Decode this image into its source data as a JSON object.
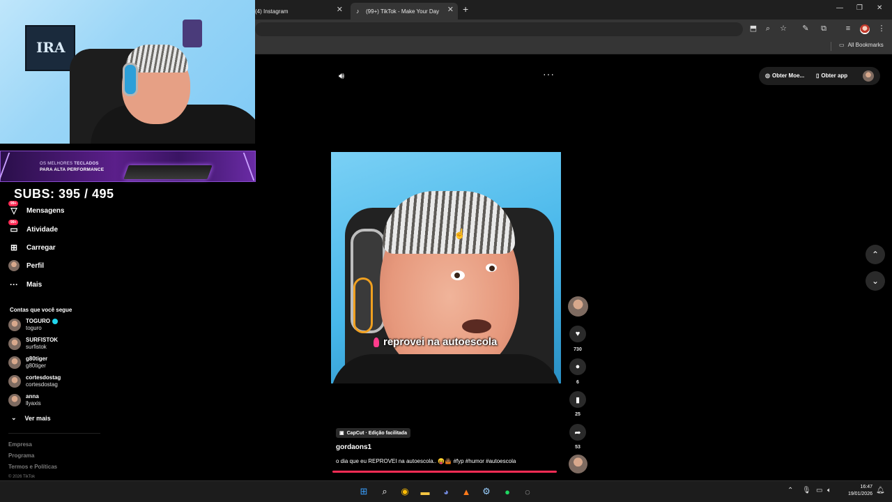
{
  "browser": {
    "tabs": [
      {
        "label": "(4) Instagram",
        "active": false
      },
      {
        "label": "(99+) TikTok - Make Your Day",
        "active": true
      }
    ],
    "new_tab_icon": "plus-icon",
    "bookmarks": {
      "all_bookmarks_label": "All Bookmarks"
    }
  },
  "overlay": {
    "banner": {
      "line1": "OS MELHORES",
      "line1_bold": "TECLADOS",
      "line2": "PARA ALTA PERFORMANCE"
    },
    "subs_counter": "SUBS: 395 / 495"
  },
  "sidebar": {
    "nav": [
      {
        "label": "Mensagens",
        "badge": "99+",
        "icon": "messages-icon"
      },
      {
        "label": "Atividade",
        "badge": "99+",
        "icon": "activity-icon"
      },
      {
        "label": "Carregar",
        "icon": "upload-icon"
      },
      {
        "label": "Perfil",
        "icon": "profile-avatar"
      },
      {
        "label": "Mais",
        "icon": "more-icon"
      }
    ],
    "following_title": "Contas que você segue",
    "following": [
      {
        "name": "TOGURO",
        "handle": "toguro",
        "verified": true
      },
      {
        "name": "SURFISTOK",
        "handle": "surfistok",
        "verified": false
      },
      {
        "name": "g80tiger",
        "handle": "g80tiger",
        "verified": false
      },
      {
        "name": "cortesdostag",
        "handle": "cortesdostag",
        "verified": false
      },
      {
        "name": "anna",
        "handle": "llyaxis",
        "verified": false
      }
    ],
    "see_more": "Ver mais",
    "footer": [
      "Empresa",
      "Programa",
      "Termos e Políticas"
    ],
    "copyright": "© 2026 TikTok"
  },
  "header": {
    "get_coins": "Obter Moe...",
    "get_app": "Obter app"
  },
  "video": {
    "caption": "reprovei na autoescola",
    "capcut_label": "CapCut · Edição facilitada",
    "author": "gordaons1",
    "description": "o dia que eu REPROVEI na autoescola.. 😝🤷🏾 #fyp #humor #autoescola",
    "progress": 0.99
  },
  "actions": {
    "likes": "730",
    "comments": "6",
    "saves": "25",
    "shares": "53"
  },
  "system": {
    "time": "16:47",
    "date": "19/01/2026"
  },
  "colors": {
    "accent": "#fe2c55",
    "background": "#000000",
    "verified": "#20d5ec"
  }
}
